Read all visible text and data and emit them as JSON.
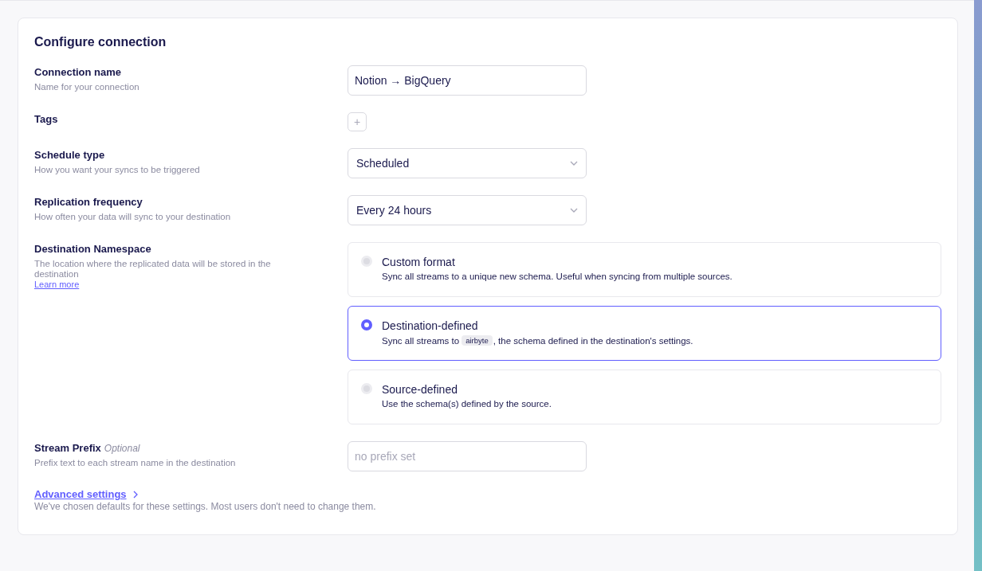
{
  "title": "Configure connection",
  "fields": [
    {
      "kind": "text",
      "label": "Connection name",
      "description": "Name for your connection",
      "value": "Notion → BigQuery"
    },
    {
      "kind": "tags",
      "label": "Tags",
      "add_symbol": "+"
    },
    {
      "kind": "select",
      "label": "Schedule type",
      "description": "How you want your syncs to be triggered",
      "value": "Scheduled"
    },
    {
      "kind": "select",
      "label": "Replication frequency",
      "description": "How often your data will sync to your destination",
      "value": "Every 24 hours"
    },
    {
      "kind": "radio",
      "label": "Destination Namespace",
      "description": "The location where the replicated data will be stored in the destination",
      "link": "Learn more",
      "options": [
        {
          "title": "Custom format",
          "selected": false,
          "segments": [
            {
              "kind": "text",
              "text": "Sync all streams to a unique new schema. Useful when syncing from multiple sources."
            }
          ]
        },
        {
          "title": "Destination-defined",
          "selected": true,
          "segments": [
            {
              "kind": "text",
              "text": "Sync all streams to"
            },
            {
              "kind": "code",
              "text": "airbyte"
            },
            {
              "kind": "text",
              "text": ", the schema defined in the destination's settings."
            }
          ]
        },
        {
          "title": "Source-defined",
          "selected": false,
          "segments": [
            {
              "kind": "text",
              "text": "Use the schema(s) defined by the source."
            }
          ]
        }
      ]
    },
    {
      "kind": "text",
      "label": "Stream Prefix",
      "optional": "Optional",
      "description": "Prefix text to each stream name in the destination",
      "placeholder": "no prefix set"
    }
  ],
  "advanced": {
    "link": "Advanced settings",
    "note": "We've chosen defaults for these settings. Most users don't need to change them."
  }
}
